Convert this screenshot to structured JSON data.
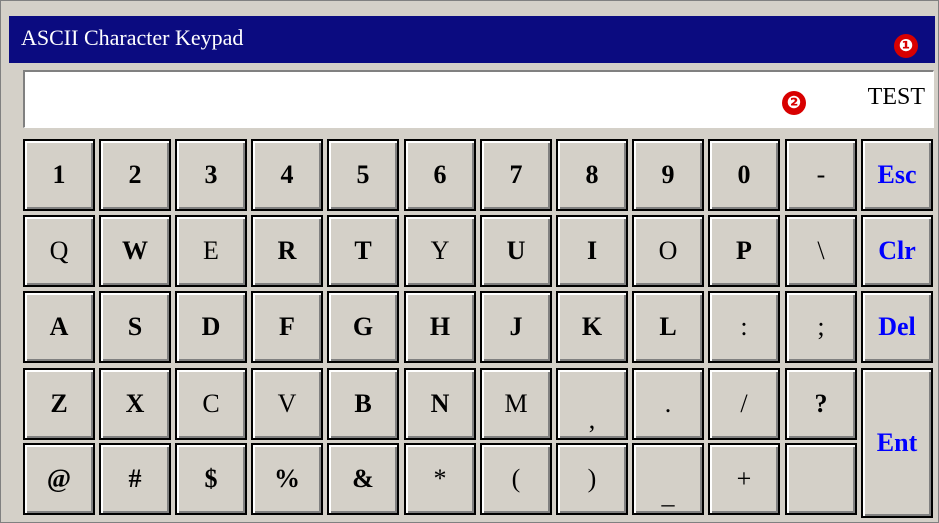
{
  "window": {
    "title": "ASCII Character Keypad",
    "callouts": [
      "❶",
      "❷"
    ]
  },
  "display": {
    "value": "TEST"
  },
  "keys": {
    "row1": [
      "1",
      "2",
      "3",
      "4",
      "5",
      "6",
      "7",
      "8",
      "9",
      "0",
      "-"
    ],
    "row2": [
      "Q",
      "W",
      "E",
      "R",
      "T",
      "Y",
      "U",
      "I",
      "O",
      "P",
      "\\"
    ],
    "row3": [
      "A",
      "S",
      "D",
      "F",
      "G",
      "H",
      "J",
      "K",
      "L",
      ":",
      ";"
    ],
    "row4": [
      "Z",
      "X",
      "C",
      "V",
      "B",
      "N",
      "M",
      ",",
      ".",
      "/",
      "?"
    ],
    "row5": [
      "@",
      "#",
      "$",
      "%",
      "&",
      "*",
      "(",
      ")",
      "_",
      "+",
      ""
    ],
    "functions": {
      "esc": "Esc",
      "clr": "Clr",
      "del": "Del",
      "ent": "Ent"
    }
  },
  "colors": {
    "titlebar": "#0b0b80",
    "function_key_text": "#0000ff",
    "callout": "#d80000",
    "key_face": "#d4d0c8"
  }
}
